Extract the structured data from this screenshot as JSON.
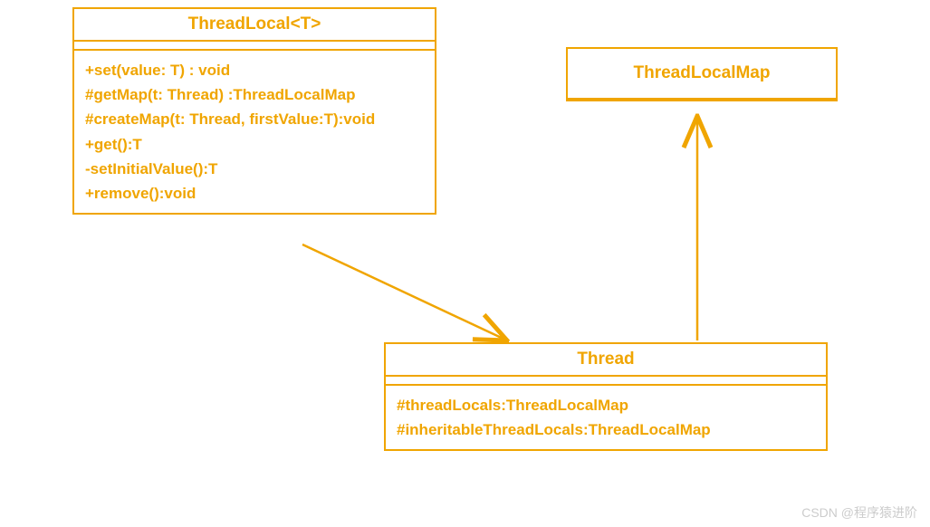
{
  "classes": {
    "threadlocal": {
      "name": "ThreadLocal<T>",
      "methods": [
        "+set(value: T) : void",
        "#getMap(t: Thread) :ThreadLocalMap",
        "#createMap(t: Thread, firstValue:T):void",
        "+get():T",
        "-setInitialValue():T",
        "+remove():void"
      ]
    },
    "threadlocalmap": {
      "name": "ThreadLocalMap"
    },
    "thread": {
      "name": "Thread",
      "fields": [
        "#threadLocals:ThreadLocalMap",
        "#inheritableThreadLocals:ThreadLocalMap"
      ]
    }
  },
  "watermark": "CSDN @程序猿进阶"
}
